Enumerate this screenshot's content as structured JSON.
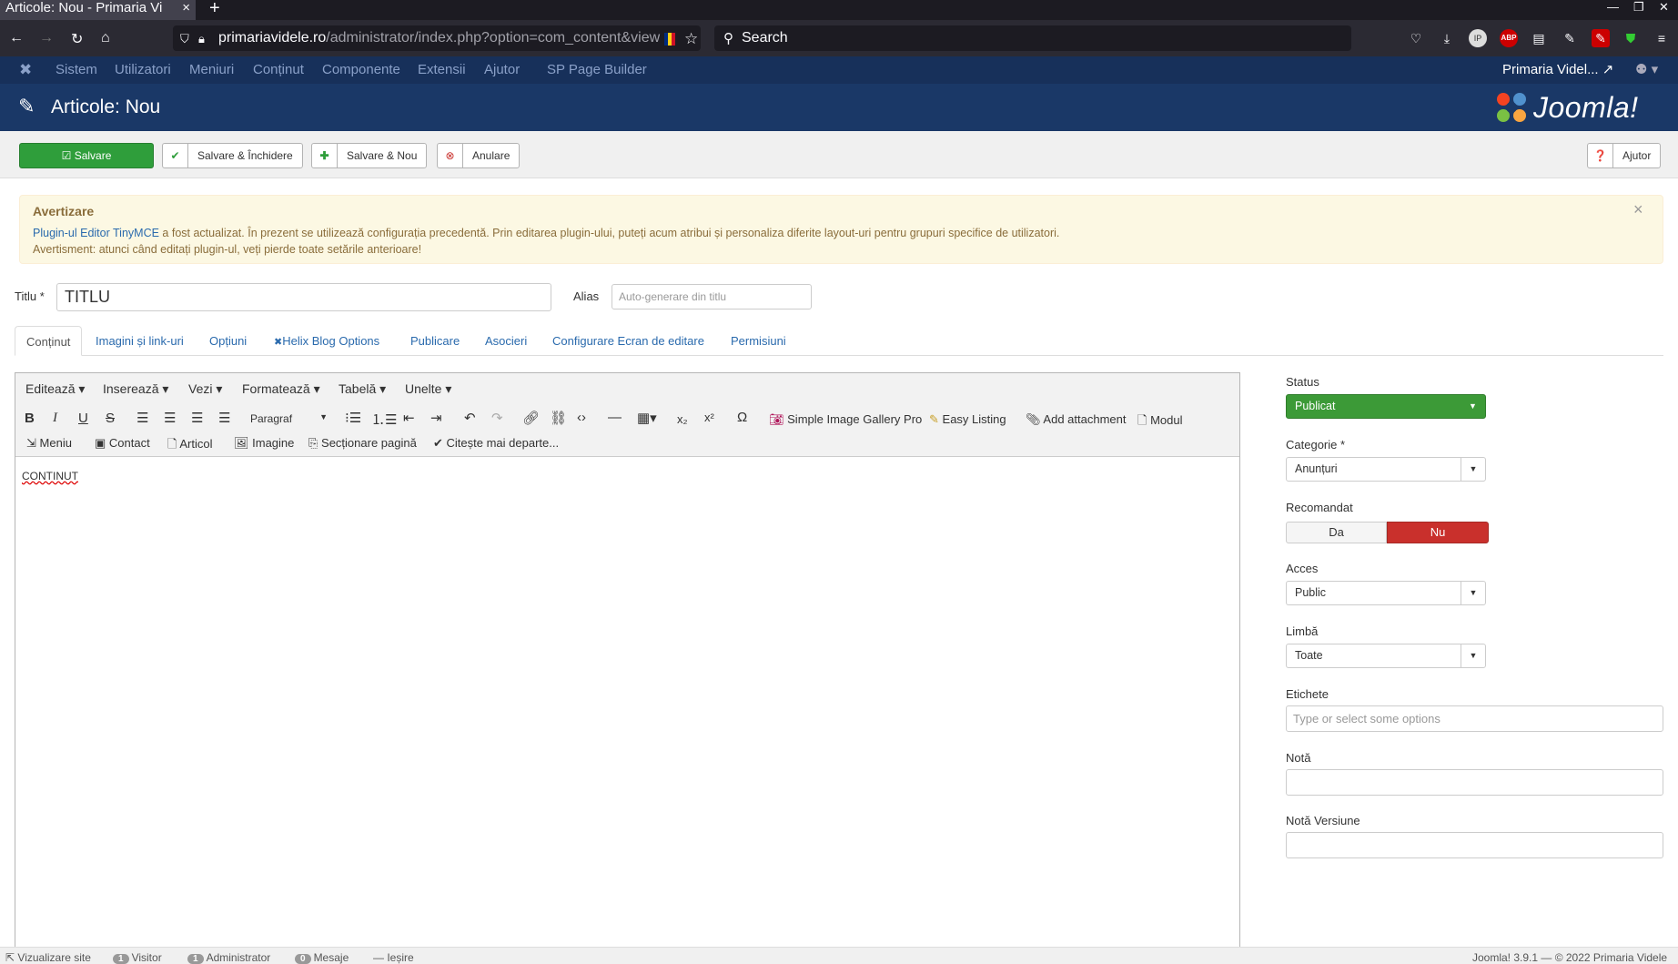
{
  "browser": {
    "tab_title": "Articole: Nou - Primaria Vi",
    "tab_close": "×",
    "new_tab": "+",
    "url_host": "primariavidele.ro",
    "url_path": "/administrator/index.php?option=com_content&view",
    "search_placeholder": "Search"
  },
  "menu": {
    "logo": "✖",
    "items": [
      "Sistem",
      "Utilizatori",
      "Meniuri",
      "Conținut",
      "Componente",
      "Extensii",
      "Ajutor",
      "SP Page Builder"
    ],
    "site_link": "Primaria Videl...",
    "user_icon": "👤"
  },
  "header": {
    "title": "Articole: Nou",
    "logo_text": "Joomla!"
  },
  "toolbar": {
    "save": "Salvare",
    "save_close": "Salvare & Închidere",
    "save_new": "Salvare & Nou",
    "cancel": "Anulare",
    "help": "Ajutor"
  },
  "warning": {
    "title": "Avertizare",
    "link_text": "Plugin-ul Editor TinyMCE",
    "line1_rest": " a fost actualizat. În prezent se utilizează configurația precedentă. Prin editarea plugin-ului, puteți acum atribui și personaliza diferite layout-uri pentru grupuri specifice de utilizatori.",
    "line2": "Avertisment: atunci când editați plugin-ul, veți pierde toate setările anterioare!",
    "close": "×"
  },
  "form": {
    "title_label": "Titlu *",
    "title_value": "TITLU",
    "alias_label": "Alias",
    "alias_placeholder": "Auto-generare din titlu"
  },
  "tabs": [
    "Conținut",
    "Imagini și link-uri",
    "Opțiuni",
    "Helix Blog Options",
    "Publicare",
    "Asocieri",
    "Configurare Ecran de editare",
    "Permisiuni"
  ],
  "editor": {
    "menus": [
      "Editează",
      "Inserează",
      "Vezi",
      "Formatează",
      "Tabelă",
      "Unelte"
    ],
    "format_select": "Paragraf",
    "buttons_row2": {
      "gallery": "Simple Image Gallery Pro",
      "easy_listing": "Easy Listing",
      "attachment": "Add attachment",
      "module": "Modul"
    },
    "buttons_row3": {
      "menu": "Meniu",
      "contact": "Contact",
      "article": "Articol",
      "image": "Imagine",
      "pagebreak": "Secționare pagină",
      "readmore": "Citește mai departe..."
    },
    "content": "CONTINUT"
  },
  "sidebar": {
    "status_label": "Status",
    "status_value": "Publicat",
    "category_label": "Categorie *",
    "category_value": "Anunțuri",
    "featured_label": "Recomandat",
    "featured_yes": "Da",
    "featured_no": "Nu",
    "access_label": "Acces",
    "access_value": "Public",
    "language_label": "Limbă",
    "language_value": "Toate",
    "tags_label": "Etichete",
    "tags_placeholder": "Type or select some options",
    "note_label": "Notă",
    "version_note_label": "Notă Versiune"
  },
  "statusbar": {
    "view_site": "Vizualizare site",
    "visitors_count": "1",
    "visitors": "Visitor",
    "admins_count": "1",
    "admins": "Administrator",
    "messages_count": "0",
    "messages": "Mesaje",
    "logout": "Ieșire",
    "footer": "Joomla! 3.9.1  —  © 2022 Primaria Videle"
  },
  "colors": {
    "menu_bg": "#17305a",
    "header_bg": "#1a3867",
    "save_green": "#2f9e3b",
    "status_green": "#3c9a37",
    "no_red": "#c9302c",
    "warning_bg": "#fcf8e3"
  }
}
